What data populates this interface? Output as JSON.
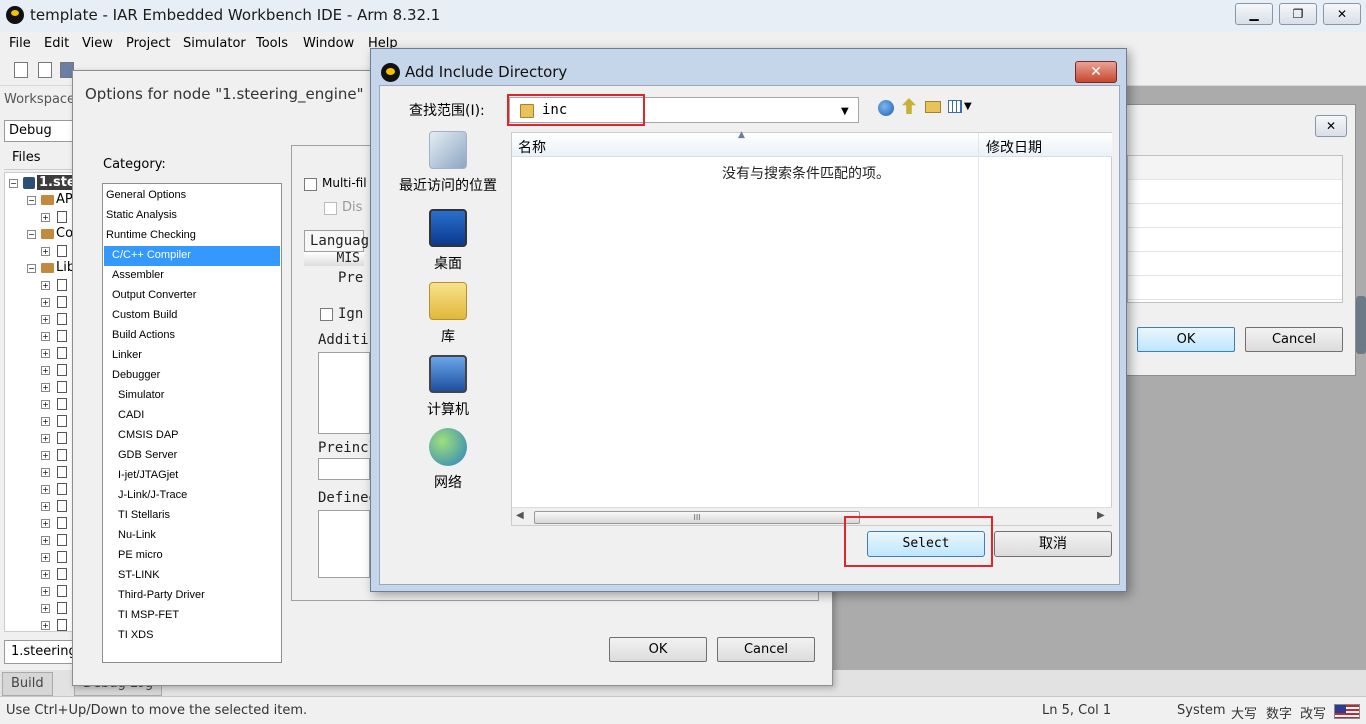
{
  "window": {
    "title": "template - IAR Embedded Workbench IDE - Arm 8.32.1",
    "minimize": "▁",
    "restore": "❐",
    "close": "✕"
  },
  "menu": [
    "File",
    "Edit",
    "View",
    "Project",
    "Simulator",
    "Tools",
    "Window",
    "Help"
  ],
  "workspace": {
    "label": "Workspace",
    "config": "Debug",
    "files_header": "Files",
    "tree": [
      {
        "label": "1.stee",
        "level": 0,
        "selected": true
      },
      {
        "label": "AP",
        "level": 1
      },
      {
        "label": "",
        "level": 2
      },
      {
        "label": "Co",
        "level": 1
      },
      {
        "label": "",
        "level": 2
      },
      {
        "label": "Lib",
        "level": 1
      }
    ],
    "bottom_tab": "1.steering"
  },
  "bottom_tabs": [
    "Build",
    "Debug Log"
  ],
  "status": {
    "hint": "Use Ctrl+Up/Down to move the selected item.",
    "position": "Ln 5, Col 1",
    "system": "System",
    "caps": "大写",
    "num": "数字",
    "ovr": "改写"
  },
  "options_dialog": {
    "title": "Options for node \"1.steering_engine\"",
    "category_label": "Category:",
    "categories": [
      {
        "label": "General Options",
        "indent": 0
      },
      {
        "label": "Static Analysis",
        "indent": 0
      },
      {
        "label": "Runtime Checking",
        "indent": 0
      },
      {
        "label": "C/C++ Compiler",
        "indent": 1,
        "selected": true
      },
      {
        "label": "Assembler",
        "indent": 1
      },
      {
        "label": "Output Converter",
        "indent": 1
      },
      {
        "label": "Custom Build",
        "indent": 1
      },
      {
        "label": "Build Actions",
        "indent": 1
      },
      {
        "label": "Linker",
        "indent": 1
      },
      {
        "label": "Debugger",
        "indent": 1
      },
      {
        "label": "Simulator",
        "indent": 2
      },
      {
        "label": "CADI",
        "indent": 2
      },
      {
        "label": "CMSIS DAP",
        "indent": 2
      },
      {
        "label": "GDB Server",
        "indent": 2
      },
      {
        "label": "I-jet/JTAGjet",
        "indent": 2
      },
      {
        "label": "J-Link/J-Trace",
        "indent": 2
      },
      {
        "label": "TI Stellaris",
        "indent": 2
      },
      {
        "label": "Nu-Link",
        "indent": 2
      },
      {
        "label": "PE micro",
        "indent": 2
      },
      {
        "label": "ST-LINK",
        "indent": 2
      },
      {
        "label": "Third-Party Driver",
        "indent": 2
      },
      {
        "label": "TI MSP-FET",
        "indent": 2
      },
      {
        "label": "TI XDS",
        "indent": 2
      }
    ],
    "multifile": "Multi-fil",
    "discard": "Dis",
    "tab_language": "Languag",
    "tab_misra": "MIS",
    "preprocessor_tab": "Pre",
    "ignore": "Ign",
    "additional": "Additi",
    "preinclude": "Preincl",
    "defined": "Defined",
    "ok": "OK",
    "cancel": "Cancel"
  },
  "right_dialog": {
    "close": "✕",
    "ok": "OK",
    "cancel": "Cancel"
  },
  "include_dialog": {
    "title": "Add Include Directory",
    "close": "✕",
    "lookin_label": "查找范围(I):",
    "lookin_value": "inc",
    "places": [
      "最近访问的位置",
      "桌面",
      "库",
      "计算机",
      "网络"
    ],
    "columns": [
      "名称",
      "修改日期"
    ],
    "empty_message": "没有与搜索条件匹配的项。",
    "scroll_grip": "III",
    "select": "Select",
    "cancel": "取消"
  },
  "colors": {
    "highlight_red": "#e0262c",
    "selection_blue": "#3399ff"
  }
}
